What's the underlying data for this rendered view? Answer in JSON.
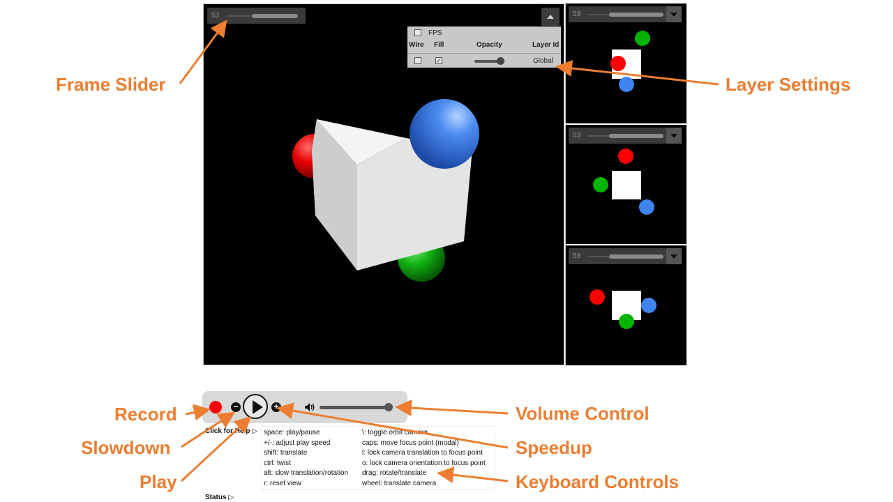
{
  "main_view": {
    "frame_number": "53",
    "layer_settings": {
      "fps_label": "FPS",
      "fps_checked": false,
      "columns": [
        "Wire",
        "Fill",
        "Opacity",
        "Layer Id"
      ],
      "rows": [
        {
          "wire": false,
          "fill": true,
          "opacity": 1.0,
          "layer_id": "Global"
        }
      ]
    }
  },
  "side_views": [
    {
      "frame_number": "53"
    },
    {
      "frame_number": "53"
    },
    {
      "frame_number": "53"
    }
  ],
  "player": {
    "speed_down_glyph": "−",
    "speed_up_glyph": "+",
    "volume_level": 1.0,
    "volume_glyph": "🔊"
  },
  "help": {
    "toggle_label": "Click for Help ▷",
    "status_label": "Status ▷",
    "left_column": [
      "space: play/pause",
      "+/-: adjust play speed",
      "shift: translate",
      "ctrl: twist",
      "alt: slow translation/rotation",
      "r: reset view"
    ],
    "right_column": [
      "\\: toggle orbit camera",
      "caps: move focus point (modal)",
      "l: lock camera translation to focus point",
      "o: lock camera orientation to focus point",
      "drag: rotate/translate",
      "wheel: translate camera"
    ]
  },
  "annotations": {
    "frame_slider": "Frame Slider",
    "layer_settings": "Layer Settings",
    "record": "Record",
    "slowdown": "Slowdown",
    "play": "Play",
    "volume_control": "Volume Control",
    "speedup": "Speedup",
    "keyboard_controls": "Keyboard Controls"
  },
  "colors": {
    "annotation": "#ed7d31",
    "record": "#ff0000",
    "sphere_red": "#e8000b",
    "sphere_green": "#00a800",
    "sphere_blue": "#3f7fe8"
  }
}
